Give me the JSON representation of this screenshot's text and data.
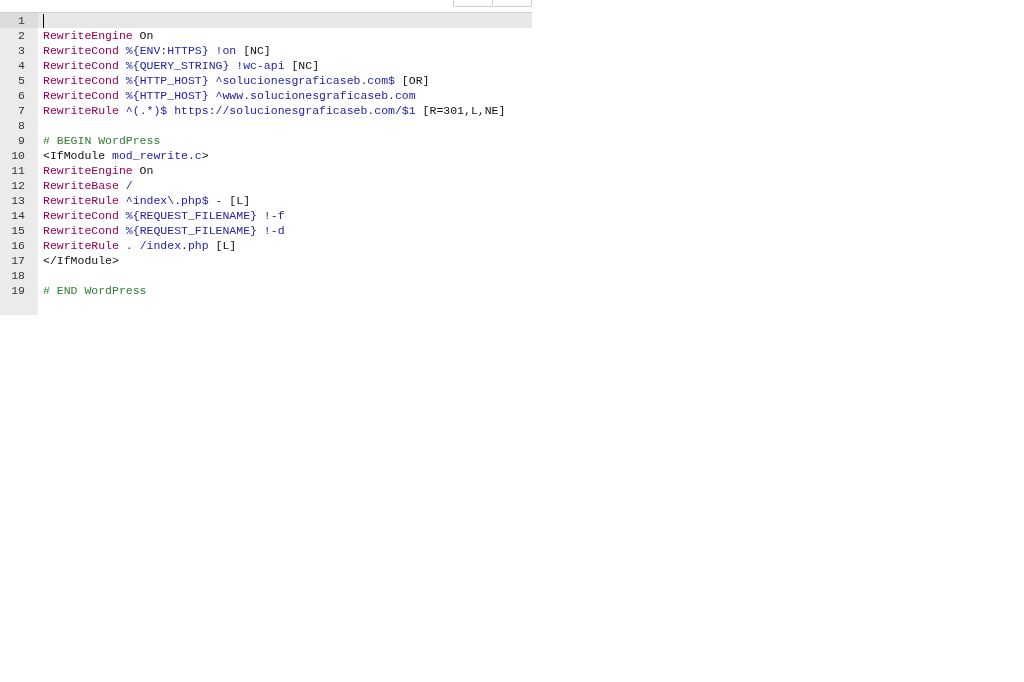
{
  "lines": [
    {
      "number": "1",
      "active": true
    },
    {
      "number": "2",
      "active": false,
      "tokens": [
        {
          "kind": "keyword",
          "text": "RewriteEngine"
        },
        {
          "kind": "plain",
          "text": " On"
        }
      ]
    },
    {
      "number": "3",
      "active": false,
      "tokens": [
        {
          "kind": "keyword",
          "text": "RewriteCond"
        },
        {
          "kind": "atom",
          "text": " %{ENV:HTTPS} !on"
        },
        {
          "kind": "plain",
          "text": " [NC]"
        }
      ]
    },
    {
      "number": "4",
      "active": false,
      "tokens": [
        {
          "kind": "keyword",
          "text": "RewriteCond"
        },
        {
          "kind": "atom",
          "text": " %{QUERY_STRING} !wc-api"
        },
        {
          "kind": "plain",
          "text": " [NC]"
        }
      ]
    },
    {
      "number": "5",
      "active": false,
      "tokens": [
        {
          "kind": "keyword",
          "text": "RewriteCond"
        },
        {
          "kind": "atom",
          "text": " %{HTTP_HOST} ^solucionesgraficaseb.com$"
        },
        {
          "kind": "plain",
          "text": " [OR]"
        }
      ]
    },
    {
      "number": "6",
      "active": false,
      "tokens": [
        {
          "kind": "keyword",
          "text": "RewriteCond"
        },
        {
          "kind": "atom",
          "text": " %{HTTP_HOST} ^www.solucionesgraficaseb.com"
        }
      ]
    },
    {
      "number": "7",
      "active": false,
      "tokens": [
        {
          "kind": "keyword",
          "text": "RewriteRule"
        },
        {
          "kind": "atom",
          "text": " ^(.*)$ https://solucionesgraficaseb.com/$1"
        },
        {
          "kind": "plain",
          "text": " [R=301,L,NE]"
        }
      ]
    },
    {
      "number": "8",
      "active": false
    },
    {
      "number": "9",
      "active": false,
      "tokens": [
        {
          "kind": "comment",
          "text": "# BEGIN WordPress"
        }
      ]
    },
    {
      "number": "10",
      "active": false,
      "tokens": [
        {
          "kind": "plain",
          "text": "<IfModule"
        },
        {
          "kind": "atom",
          "text": " mod_rewrite.c"
        },
        {
          "kind": "plain",
          "text": ">"
        }
      ]
    },
    {
      "number": "11",
      "active": false,
      "tokens": [
        {
          "kind": "keyword",
          "text": "RewriteEngine"
        },
        {
          "kind": "plain",
          "text": " On"
        }
      ]
    },
    {
      "number": "12",
      "active": false,
      "tokens": [
        {
          "kind": "keyword",
          "text": "RewriteBase"
        },
        {
          "kind": "atom",
          "text": " /"
        }
      ]
    },
    {
      "number": "13",
      "active": false,
      "tokens": [
        {
          "kind": "keyword",
          "text": "RewriteRule"
        },
        {
          "kind": "atom",
          "text": " ^index\\.php$ -"
        },
        {
          "kind": "plain",
          "text": " [L]"
        }
      ]
    },
    {
      "number": "14",
      "active": false,
      "tokens": [
        {
          "kind": "keyword",
          "text": "RewriteCond"
        },
        {
          "kind": "atom",
          "text": " %{REQUEST_FILENAME} !-f"
        }
      ]
    },
    {
      "number": "15",
      "active": false,
      "tokens": [
        {
          "kind": "keyword",
          "text": "RewriteCond"
        },
        {
          "kind": "atom",
          "text": " %{REQUEST_FILENAME} !-d"
        }
      ]
    },
    {
      "number": "16",
      "active": false,
      "tokens": [
        {
          "kind": "keyword",
          "text": "RewriteRule"
        },
        {
          "kind": "atom",
          "text": " . /index.php"
        },
        {
          "kind": "plain",
          "text": " [L]"
        }
      ]
    },
    {
      "number": "17",
      "active": false,
      "tokens": [
        {
          "kind": "plain",
          "text": "</IfModule>"
        }
      ]
    },
    {
      "number": "18",
      "active": false
    },
    {
      "number": "19",
      "active": false,
      "tokens": [
        {
          "kind": "comment",
          "text": "# END WordPress"
        }
      ]
    }
  ]
}
